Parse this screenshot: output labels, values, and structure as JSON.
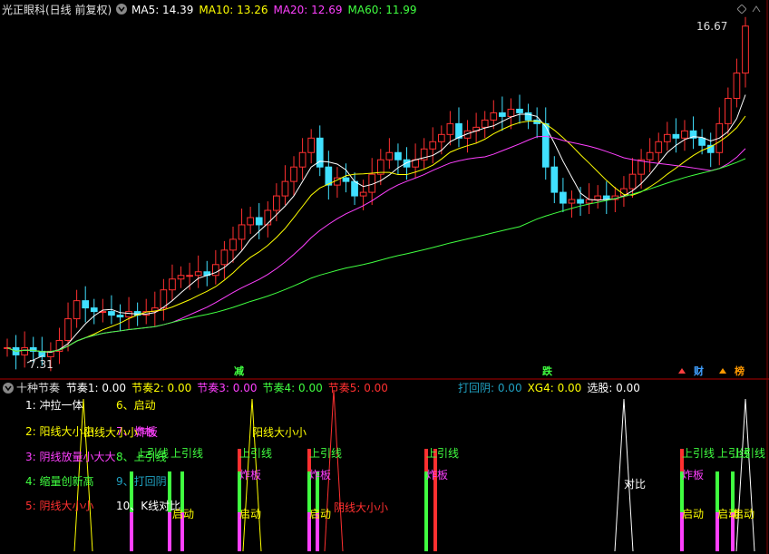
{
  "top": {
    "title": "光正眼科(日线 前复权)",
    "ma": [
      {
        "label": "MA5: 14.39",
        "color": "#ffffff"
      },
      {
        "label": "MA10: 13.26",
        "color": "#ffff00"
      },
      {
        "label": "MA20: 12.69",
        "color": "#ff40ff"
      },
      {
        "label": "MA60: 11.99",
        "color": "#40ff40"
      }
    ],
    "high_label": "16.67",
    "low_label": "7.31",
    "markers": [
      {
        "text": "减",
        "color": "#40ff40"
      },
      {
        "text": "跌",
        "color": "#40ff40"
      },
      {
        "text": "财",
        "color": "#40a0ff"
      },
      {
        "text": "榜",
        "color": "#ff9900"
      }
    ]
  },
  "bottom": {
    "title": "十种节奏",
    "params": [
      {
        "label": "节奏1: 0.00",
        "color": "#ffffff"
      },
      {
        "label": "节奏2: 0.00",
        "color": "#ffff00"
      },
      {
        "label": "节奏3: 0.00",
        "color": "#ff40ff"
      },
      {
        "label": "节奏4: 0.00",
        "color": "#40ff40"
      },
      {
        "label": "节奏5: 0.00",
        "color": "#ff3030"
      }
    ],
    "params2": [
      {
        "label": "打回阴: 0.00",
        "color": "#20a0c0"
      },
      {
        "label": "XG4: 0.00",
        "color": "#ffff00"
      },
      {
        "label": "选股: 0.00",
        "color": "#ffffff"
      }
    ],
    "legend": [
      {
        "text": "1:  冲拉一体",
        "color": "#ffffff"
      },
      {
        "text": "2:  阳线大小小",
        "color": "#ffff00"
      },
      {
        "text": "3:  阴线放量小大大",
        "color": "#ff40ff"
      },
      {
        "text": "4:  缩量创新高",
        "color": "#40ff40"
      },
      {
        "text": "5:  阴线大小小",
        "color": "#ff3030"
      },
      {
        "text": "6、启动",
        "color": "#ffff00"
      },
      {
        "text": "7、炸板",
        "color": "#ff40ff"
      },
      {
        "text": "8、上引线",
        "color": "#40ff40"
      },
      {
        "text": "9、打回阴",
        "color": "#20a0c0"
      },
      {
        "text": "10、K线对比",
        "color": "#ffffff"
      }
    ],
    "annotations": [
      {
        "text": "阳线大小小",
        "color": "#ffff00"
      },
      {
        "text": "炸板",
        "color": "#ff40ff"
      },
      {
        "text": "上引线",
        "color": "#40ff40"
      },
      {
        "text": "上引线",
        "color": "#40ff40"
      },
      {
        "text": "阳线大小小",
        "color": "#ffff00"
      },
      {
        "text": "上引线",
        "color": "#40ff40"
      },
      {
        "text": "炸板",
        "color": "#ff40ff"
      },
      {
        "text": "启动",
        "color": "#ffff00"
      },
      {
        "text": "上引线",
        "color": "#40ff40"
      },
      {
        "text": "炸板",
        "color": "#ff40ff"
      },
      {
        "text": "启动",
        "color": "#ffff00"
      },
      {
        "text": "阴线大小小",
        "color": "#ff3030"
      },
      {
        "text": "上引线",
        "color": "#40ff40"
      },
      {
        "text": "炸板",
        "color": "#ff40ff"
      },
      {
        "text": "对比",
        "color": "#ffffff"
      },
      {
        "text": "上引线",
        "color": "#40ff40"
      },
      {
        "text": "炸板",
        "color": "#ff40ff"
      },
      {
        "text": "上引线",
        "color": "#40ff40"
      },
      {
        "text": "上引线",
        "color": "#40ff40"
      },
      {
        "text": "启动",
        "color": "#ffff00"
      },
      {
        "text": "启动",
        "color": "#ffff00"
      },
      {
        "text": "启动",
        "color": "#ffff00"
      },
      {
        "text": "启动",
        "color": "#ffff00"
      }
    ]
  }
}
